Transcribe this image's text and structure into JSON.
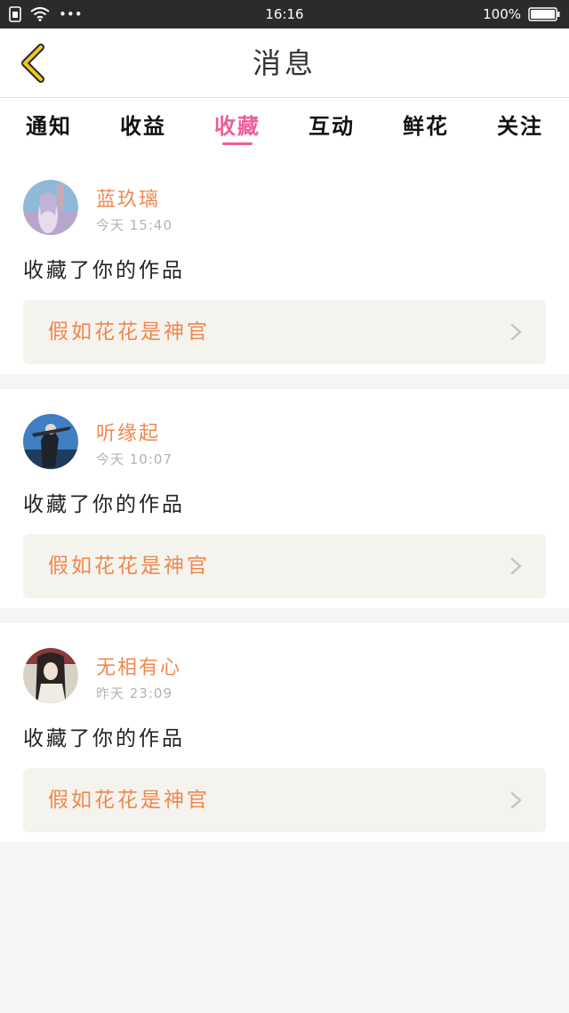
{
  "status_bar": {
    "time": "16:16",
    "battery": "100%",
    "dots": "•••"
  },
  "header": {
    "title": "消息"
  },
  "tabs": [
    {
      "label": "通知"
    },
    {
      "label": "收益"
    },
    {
      "label": "收藏"
    },
    {
      "label": "互动"
    },
    {
      "label": "鲜花"
    },
    {
      "label": "关注"
    }
  ],
  "messages": [
    {
      "user": "蓝玖璃",
      "time": "今天 15:40",
      "action": "收藏了你的作品",
      "work": "假如花花是神官"
    },
    {
      "user": "听缘起",
      "time": "今天 10:07",
      "action": "收藏了你的作品",
      "work": "假如花花是神官"
    },
    {
      "user": "无相有心",
      "time": "昨天 23:09",
      "action": "收藏了你的作品",
      "work": "假如花花是神官"
    }
  ],
  "colors": {
    "accent": "#ec5f9a",
    "name": "#f0884e",
    "back_icon": "#f3c623"
  }
}
